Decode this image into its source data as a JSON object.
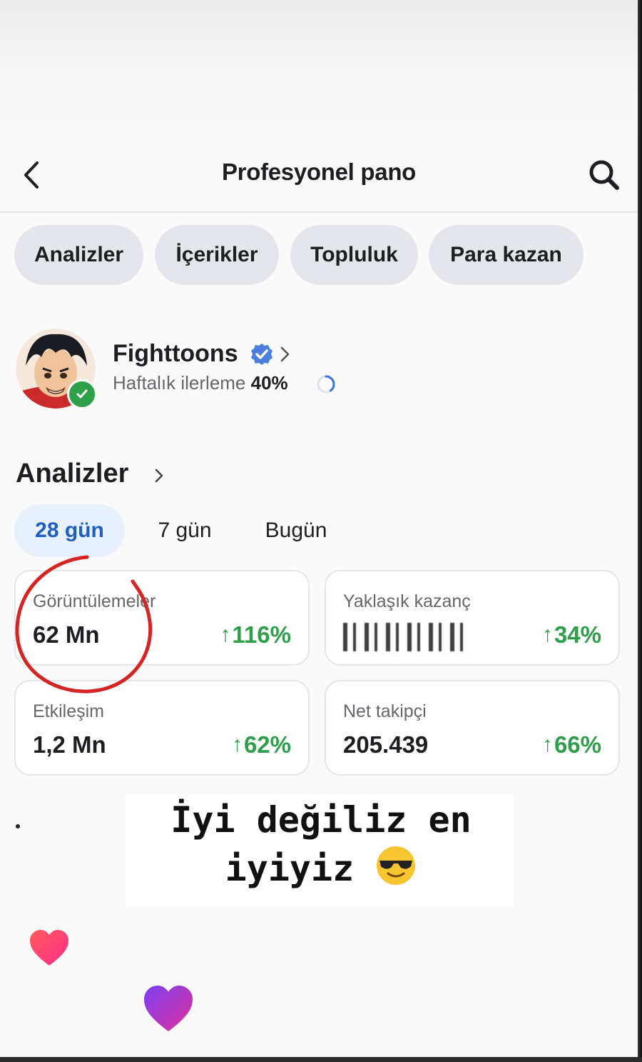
{
  "header": {
    "title": "Profesyonel pano",
    "back_icon": "chevron-left-icon",
    "search_icon": "search-icon"
  },
  "tabs": [
    {
      "label": "Analizler"
    },
    {
      "label": "İçerikler"
    },
    {
      "label": "Topluluk"
    },
    {
      "label": "Para kazan"
    }
  ],
  "profile": {
    "name": "Fighttoons",
    "verified": true,
    "progress_label": "Haftalık ilerleme",
    "progress_value": "40%",
    "progress_fraction": 0.4
  },
  "analytics": {
    "title": "Analizler",
    "ranges": [
      {
        "label": "28 gün",
        "active": true
      },
      {
        "label": "7 gün",
        "active": false
      },
      {
        "label": "Bugün",
        "active": false
      }
    ],
    "cards": [
      {
        "label": "Görüntülemeler",
        "value": "62 Mn",
        "change": "116%"
      },
      {
        "label": "Yaklaşık kazanç",
        "value": "",
        "change": "34%",
        "redacted": true
      },
      {
        "label": "Etkileşim",
        "value": "1,2 Mn",
        "change": "62%"
      },
      {
        "label": "Net takipçi",
        "value": "205.439",
        "change": "66%"
      }
    ],
    "change_arrow": "↑"
  },
  "overlay": {
    "caption_line1": "İyi değiliz en",
    "caption_line2": "iyiyiz",
    "emoji": "sunglasses-face-icon"
  },
  "colors": {
    "accent_blue": "#1f5fbf",
    "positive_green": "#2e9e4a",
    "verified_blue": "#4a7fe0",
    "annotation_red": "#d42424",
    "pill_gray": "#e4e6eb"
  }
}
